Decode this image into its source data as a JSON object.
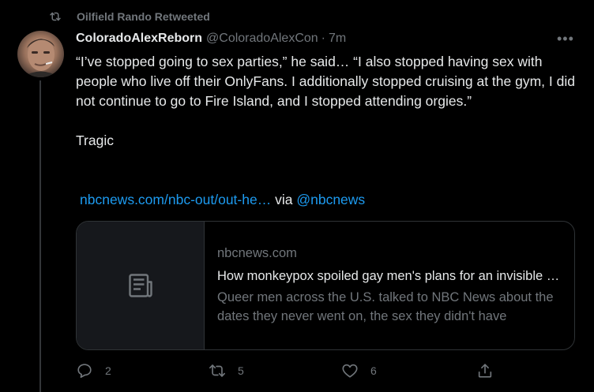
{
  "retweet_context": {
    "label": "Oilfield Rando Retweeted",
    "icon": "retweet-icon"
  },
  "tweet": {
    "author_name": "ColoradoAlexReborn",
    "handle": "@ColoradoAlexCon",
    "separator": "·",
    "time": "7m",
    "more_icon": "more-icon",
    "more_glyph": "•••",
    "text_paragraph_1": "“I’ve stopped going to sex parties,” he said… “I also stopped having sex with people who live off their OnlyFans. I additionally stopped cruising at the gym, I did not continue to go to Fire Island, and I stopped attending orgies.”",
    "text_paragraph_2": "Tragic",
    "link_text": "nbcnews.com/nbc-out/out-he…",
    "via_text": "via",
    "via_handle": "@nbcnews"
  },
  "card": {
    "domain": "nbcnews.com",
    "title": "How monkeypox spoiled gay men's plans for an invisible summer",
    "description": "Queer men across the U.S. talked to NBC News about the dates they never went on, the sex they didn't have",
    "thumb_icon": "article-icon"
  },
  "actions": {
    "reply_count": "2",
    "retweet_count": "5",
    "like_count": "6",
    "share_icon": "share-icon"
  },
  "colors": {
    "background": "#000000",
    "text": "#e7e9ea",
    "muted": "#71767b",
    "link": "#1d9bf0",
    "border": "#2f3336"
  }
}
